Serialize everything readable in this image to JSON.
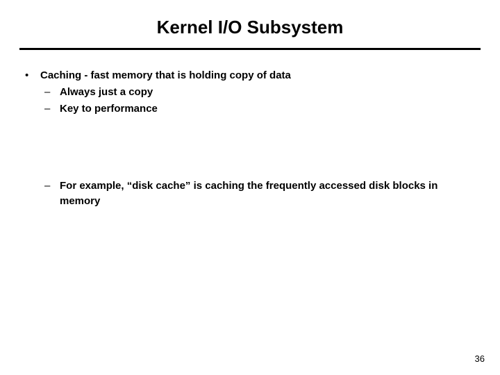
{
  "title": "Kernel I/O Subsystem",
  "bullets": [
    {
      "text": "Caching - fast memory that is holding copy of data",
      "sub": [
        {
          "text": "Always just a copy"
        },
        {
          "text": "Key to performance"
        },
        {
          "spacer": true
        },
        {
          "text": "For example,  “disk cache” is caching the frequently accessed disk blocks in memory"
        }
      ]
    }
  ],
  "page_number": "36"
}
